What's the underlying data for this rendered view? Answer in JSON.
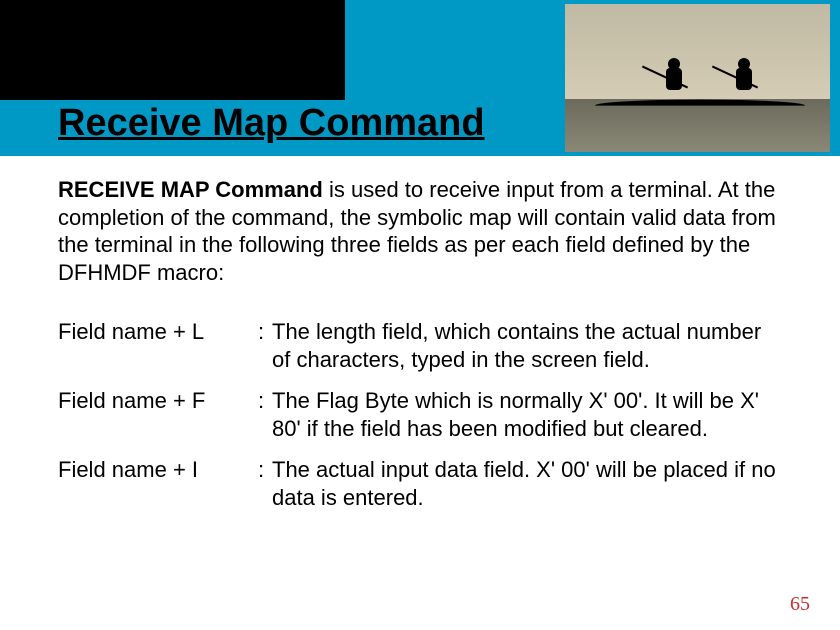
{
  "title": "Receive Map Command",
  "intro": {
    "lead": "RECEIVE MAP Command",
    "rest": "  is used to receive input from a terminal. At the completion of the command, the symbolic map will contain valid data from the terminal in the following three fields as per each field defined by the DFHMDF macro:"
  },
  "fields": [
    {
      "label": "Field name + L",
      "desc": "The length field, which contains the actual number of characters, typed in the screen field."
    },
    {
      "label": "Field name + F",
      "desc": "The Flag Byte which is normally X' 00'. It will be X' 80' if the field has been modified but cleared."
    },
    {
      "label": "Field name + I",
      "desc": "The actual input data field. X' 00' will be placed if no data is entered."
    }
  ],
  "page_number": "65"
}
